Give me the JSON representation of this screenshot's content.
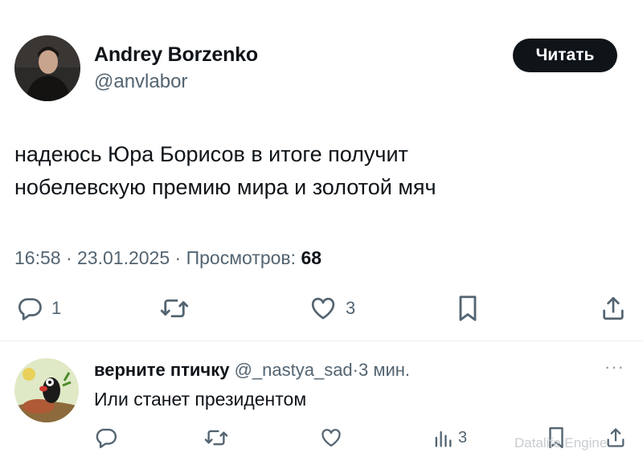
{
  "tweet": {
    "author_name": "Andrey Borzenko",
    "author_handle": "@anvlabor",
    "follow_label": "Читать",
    "text_line1": "надеюсь Юра Борисов в итоге получит",
    "text_line2": "нобелевскую премию мира и золотой мяч",
    "time": "16:58",
    "date": "23.01.2025",
    "views_label": "Просмотров:",
    "views_count": "68",
    "separator": "·",
    "actions": {
      "reply_count": "1",
      "retweet_count": "",
      "like_count": "3"
    }
  },
  "reply": {
    "name": "верните птичку",
    "handle": "@_nastya_sad",
    "separator": "·",
    "time": "3 мин.",
    "text": "Или станет президентом",
    "more_label": "···",
    "actions": {
      "views_count": "3"
    }
  },
  "watermark": "Datalife Engine",
  "icons": {
    "reply": "comment-icon",
    "retweet": "retweet-icon",
    "like": "heart-icon",
    "bookmark": "bookmark-icon",
    "share": "share-icon",
    "views": "analytics-icon",
    "more": "more-icon"
  },
  "colors": {
    "text": "#0f1419",
    "muted": "#536471",
    "button_bg": "#0f1419",
    "button_text": "#ffffff"
  }
}
